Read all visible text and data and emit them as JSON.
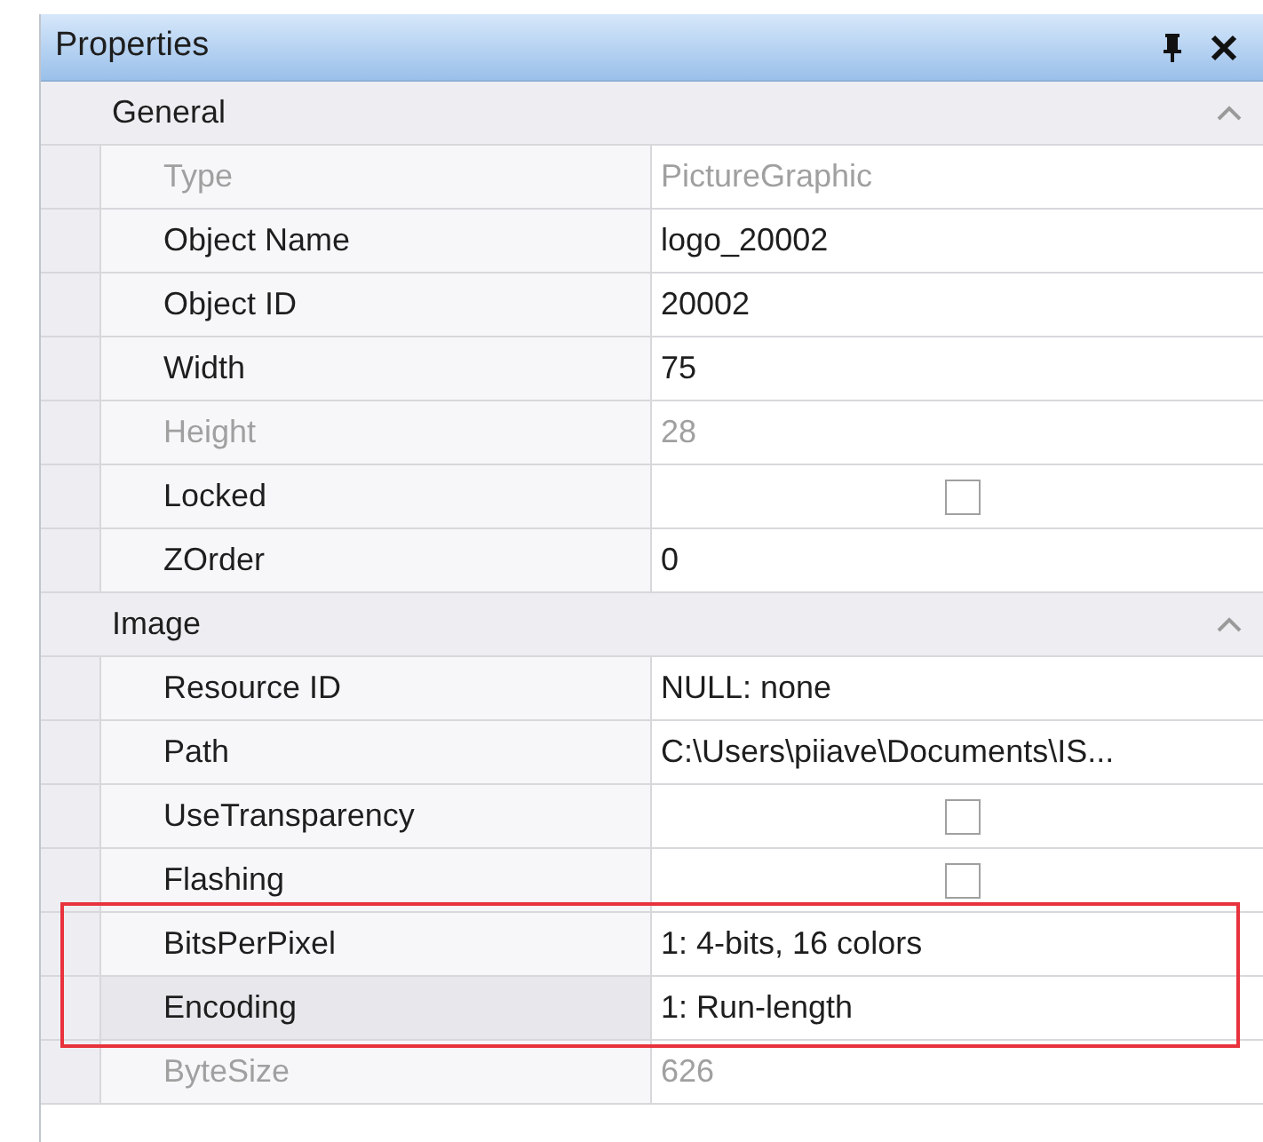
{
  "window": {
    "title": "Properties"
  },
  "groups": [
    {
      "name": "General",
      "expanded": true,
      "rows": [
        {
          "name": "Type",
          "kind": "text",
          "value": "PictureGraphic",
          "disabled": true,
          "selected": false
        },
        {
          "name": "Object Name",
          "kind": "text",
          "value": "logo_20002",
          "disabled": false,
          "selected": false
        },
        {
          "name": "Object ID",
          "kind": "text",
          "value": "20002",
          "disabled": false,
          "selected": false
        },
        {
          "name": "Width",
          "kind": "text",
          "value": "75",
          "disabled": false,
          "selected": false
        },
        {
          "name": "Height",
          "kind": "text",
          "value": "28",
          "disabled": true,
          "selected": false
        },
        {
          "name": "Locked",
          "kind": "checkbox",
          "checked": false,
          "disabled": false,
          "selected": false
        },
        {
          "name": "ZOrder",
          "kind": "text",
          "value": "0",
          "disabled": false,
          "selected": false
        }
      ]
    },
    {
      "name": "Image",
      "expanded": true,
      "rows": [
        {
          "name": "Resource ID",
          "kind": "text",
          "value": "NULL: none",
          "disabled": false,
          "selected": false
        },
        {
          "name": "Path",
          "kind": "text",
          "value": "C:\\Users\\piiave\\Documents\\IS...",
          "disabled": false,
          "selected": false
        },
        {
          "name": "UseTransparency",
          "kind": "checkbox",
          "checked": false,
          "disabled": false,
          "selected": false
        },
        {
          "name": "Flashing",
          "kind": "checkbox",
          "checked": false,
          "disabled": false,
          "selected": false
        },
        {
          "name": "BitsPerPixel",
          "kind": "text",
          "value": "1: 4-bits, 16 colors",
          "disabled": false,
          "selected": false
        },
        {
          "name": "Encoding",
          "kind": "text",
          "value": "1: Run-length",
          "disabled": false,
          "selected": true
        },
        {
          "name": "ByteSize",
          "kind": "text",
          "value": "626",
          "disabled": true,
          "selected": false
        }
      ]
    }
  ]
}
